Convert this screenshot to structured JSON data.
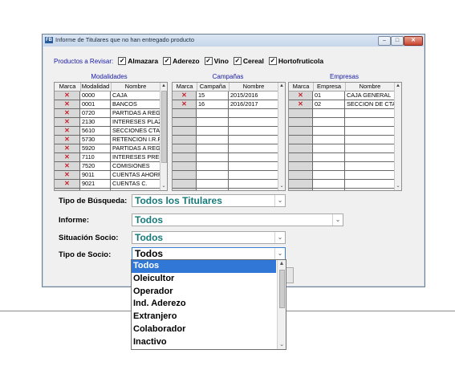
{
  "window": {
    "icon_text": "FB",
    "title": "Informe de Titulares que no han entregado producto",
    "minimize_icon": "minimize-icon",
    "maximize_icon": "maximize-icon",
    "close_icon": "close-icon"
  },
  "products": {
    "label": "Productos a Revisar:",
    "items": [
      {
        "label": "Almazara",
        "checked": true
      },
      {
        "label": "Aderezo",
        "checked": true
      },
      {
        "label": "Vino",
        "checked": true
      },
      {
        "label": "Cereal",
        "checked": true
      },
      {
        "label": "Hortofruticola",
        "checked": true
      }
    ]
  },
  "modalidades": {
    "title": "Modalidades",
    "headers": [
      "Marca",
      "Modalidad",
      "Nombre"
    ],
    "rows": [
      {
        "code": "0000",
        "name": "CAJA"
      },
      {
        "code": "0001",
        "name": "BANCOS"
      },
      {
        "code": "0720",
        "name": "PARTIDAS A REGULARIZAR"
      },
      {
        "code": "2130",
        "name": "INTERESES PLAZO"
      },
      {
        "code": "5610",
        "name": "SECCIONES CTA"
      },
      {
        "code": "5730",
        "name": "RETENCION I.R.P.F."
      },
      {
        "code": "5920",
        "name": "PARTIDAS A REGULARIZAR"
      },
      {
        "code": "7110",
        "name": "INTERESES PRESTAMOS"
      },
      {
        "code": "7520",
        "name": "COMISIONES"
      },
      {
        "code": "9011",
        "name": "CUENTAS AHORRO"
      },
      {
        "code": "9021",
        "name": "CUENTAS C."
      }
    ]
  },
  "campanas": {
    "title": "Campañas",
    "headers": [
      "Marca",
      "Campaña",
      "Nombre"
    ],
    "rows": [
      {
        "code": "15",
        "name": "2015/2016"
      },
      {
        "code": "16",
        "name": "2016/2017"
      }
    ]
  },
  "empresas": {
    "title": "Empresas",
    "headers": [
      "Marca",
      "Empresa",
      "Nombre"
    ],
    "rows": [
      {
        "code": "01",
        "name": "CAJA GENERAL"
      },
      {
        "code": "02",
        "name": "SECCION DE CTA"
      }
    ]
  },
  "mark_symbol": "✕",
  "fields": {
    "tipo_busqueda": {
      "label": "Tipo de Búsqueda:",
      "value": "Todos los Titulares"
    },
    "informe": {
      "label": "Informe:",
      "value": "Todos"
    },
    "situacion_socio": {
      "label": "Situación Socio:",
      "value": "Todos"
    },
    "tipo_socio": {
      "label": "Tipo de Socio:",
      "value": "Todos"
    }
  },
  "tipo_socio_options": [
    "Todos",
    "Oleicultor",
    "Operador",
    "Ind. Aderezo",
    "Extranjero",
    "Colaborador",
    "Inactivo"
  ],
  "colors": {
    "accent": "#3178d6",
    "value_text": "#177a7a",
    "group_title": "#1a1aa8",
    "mark": "#c8232c"
  }
}
